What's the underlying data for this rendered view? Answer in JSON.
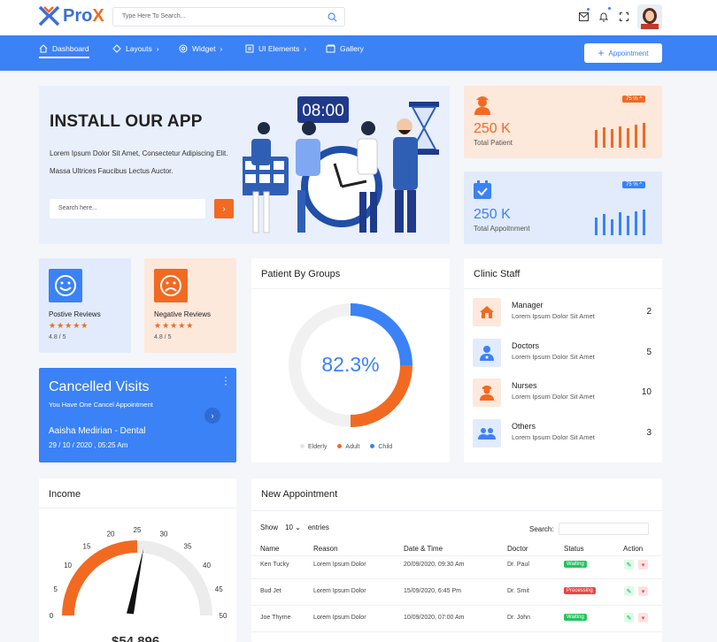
{
  "header": {
    "brand": "ProX",
    "brand_first": "Pro",
    "brand_last": "X",
    "search_placeholder": "Type Here To Search..."
  },
  "nav": {
    "items": [
      {
        "label": "Dashboard",
        "icon": "home-icon",
        "active": true
      },
      {
        "label": "Layouts",
        "icon": "layers-icon",
        "chevron": "›"
      },
      {
        "label": "Widget",
        "icon": "widget-icon",
        "chevron": "›"
      },
      {
        "label": "UI Elements",
        "icon": "ui-elements-icon",
        "chevron": "›"
      },
      {
        "label": "Gallery",
        "icon": "gallery-icon"
      }
    ],
    "appointment_button": "Appointment"
  },
  "install": {
    "title": "INSTALL OUR APP",
    "text": "Lorem Ipsum Dolor Sit Amet, Consectetur Adipiscing Elit. Massa Ultrices Faucibus Lectus Auctor.",
    "search_placeholder": "Search here...",
    "clock_text": "08:00"
  },
  "stats": [
    {
      "value": "250 K",
      "label": "Total Patient",
      "badge": "75 %",
      "color": "#f26a21"
    },
    {
      "value": "250 K",
      "label": "Total Appoitnment",
      "badge": "75 %",
      "color": "#3b82f6"
    }
  ],
  "reviews": [
    {
      "title": "Postive Reviews",
      "stars": "★★★★★",
      "rating": "4.8 / 5",
      "icon": "smile-icon"
    },
    {
      "title": "Negative Reviews",
      "stars": "★★★★★",
      "rating": "4.8 / 5",
      "icon": "sad-icon"
    }
  ],
  "cancelled": {
    "title": "Cancelled Visits",
    "subtitle": "You Have One Cancel Appointment",
    "patient": "Aaisha Medirian - Dental",
    "datetime": "29 / 10 / 2020 , 05:25 Am"
  },
  "patient_groups": {
    "title": "Patient By Groups",
    "percentage": "82.3%",
    "legend": [
      "Elderly",
      "Adult",
      "Child"
    ],
    "colors": {
      "elderly": "#f1f1f1",
      "adult": "#f26a21",
      "child": "#3b82f6"
    }
  },
  "chart_data": {
    "type": "pie",
    "title": "Patient By Groups",
    "categories": [
      "Elderly",
      "Adult",
      "Child"
    ],
    "values": [
      50,
      25,
      25
    ]
  },
  "clinic_staff": {
    "title": "Clinic Staff",
    "rows": [
      {
        "name": "Manager",
        "desc": "Lorem Ipsum Dolor Sit Amet",
        "count": "2",
        "icon": "house-icon",
        "tint": "orange"
      },
      {
        "name": "Doctors",
        "desc": "Lorem Ipsum Dolor Sit Amet",
        "count": "5",
        "icon": "doctor-icon",
        "tint": "blue"
      },
      {
        "name": "Nurses",
        "desc": "Lorem Ipsum Dolor Sit Amet",
        "count": "10",
        "icon": "nurse-icon",
        "tint": "orange"
      },
      {
        "name": "Others",
        "desc": "Lorem Ipsum Dolor Sit Amet",
        "count": "3",
        "icon": "users-icon",
        "tint": "blue"
      }
    ]
  },
  "income": {
    "title": "Income",
    "gauge_ticks": [
      "0",
      "5",
      "10",
      "15",
      "20",
      "25",
      "30",
      "35",
      "40",
      "45",
      "50"
    ],
    "gauge_value": 25,
    "amount": "$54,896"
  },
  "appointments": {
    "title": "New Appointment",
    "show_label": "Show",
    "entries_value": "10",
    "entries_label": "entries",
    "search_label": "Search:",
    "columns": [
      "Name",
      "Reason",
      "Date & Time",
      "Doctor",
      "Status",
      "Action"
    ],
    "rows": [
      {
        "name": "Ken Tucky",
        "reason": "Lorem Ipsum Dolor",
        "datetime": "20/09/2020, 09:30 Am",
        "doctor": "Dr. Paul",
        "status": "Waiting"
      },
      {
        "name": "Bud Jet",
        "reason": "Lorem Ipsum Dolor",
        "datetime": "15/09/2020, 6:45 Pm",
        "doctor": "Dr. Smit",
        "status": "Processing"
      },
      {
        "name": "Joe Thyme",
        "reason": "Lorem Ipsum Dolor",
        "datetime": "10/09/2020, 07:00 Am",
        "doctor": "Dr. John",
        "status": "Waiting"
      }
    ],
    "status_colors": {
      "Waiting": "#22c55e",
      "Processing": "#ef4444"
    }
  }
}
